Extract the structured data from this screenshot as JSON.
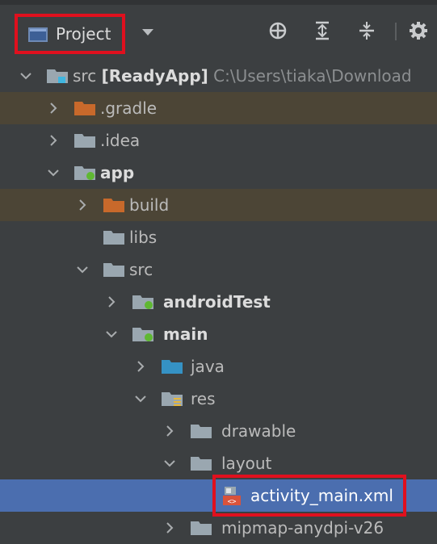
{
  "toolbar": {
    "project_label": "Project",
    "icons": [
      "locate-icon",
      "expand-all-icon",
      "collapse-all-icon",
      "settings-gear-icon"
    ]
  },
  "tree": {
    "rows": [
      {
        "depth": 0,
        "expanded": true,
        "icon": "module-folder",
        "label": "src",
        "bold_suffix": "[ReadyApp]",
        "path": "C:\\Users\\tiaka\\Download"
      },
      {
        "depth": 1,
        "expanded": false,
        "icon": "orange-folder",
        "label": ".gradle",
        "excluded": true
      },
      {
        "depth": 1,
        "expanded": false,
        "icon": "gray-folder",
        "label": ".idea"
      },
      {
        "depth": 1,
        "expanded": true,
        "icon": "module-folder",
        "label": "app",
        "bold": true
      },
      {
        "depth": 2,
        "expanded": false,
        "icon": "orange-folder",
        "label": "build",
        "excluded": true
      },
      {
        "depth": 2,
        "icon": "gray-folder",
        "label": "libs"
      },
      {
        "depth": 2,
        "expanded": true,
        "icon": "gray-folder",
        "label": "src"
      },
      {
        "depth": 3,
        "expanded": false,
        "icon": "module-folder",
        "label": "androidTest",
        "bold": true
      },
      {
        "depth": 3,
        "expanded": true,
        "icon": "module-folder",
        "label": "main",
        "bold": true
      },
      {
        "depth": 4,
        "expanded": false,
        "icon": "blue-folder",
        "label": "java"
      },
      {
        "depth": 4,
        "expanded": true,
        "icon": "res-folder",
        "label": "res"
      },
      {
        "depth": 5,
        "expanded": false,
        "icon": "gray-folder",
        "label": "drawable"
      },
      {
        "depth": 5,
        "expanded": true,
        "icon": "gray-folder",
        "label": "layout"
      },
      {
        "depth": 6,
        "icon": "layout-xml-file",
        "label": "activity_main.xml",
        "selected": true
      },
      {
        "depth": 5,
        "expanded": false,
        "icon": "gray-folder",
        "label": "mipmap-anydpi-v26"
      }
    ]
  },
  "colors": {
    "background": "#3c3f41",
    "selection": "#4b6eaf",
    "excluded": "#4c4536",
    "annotation_red": "#e0101e"
  }
}
